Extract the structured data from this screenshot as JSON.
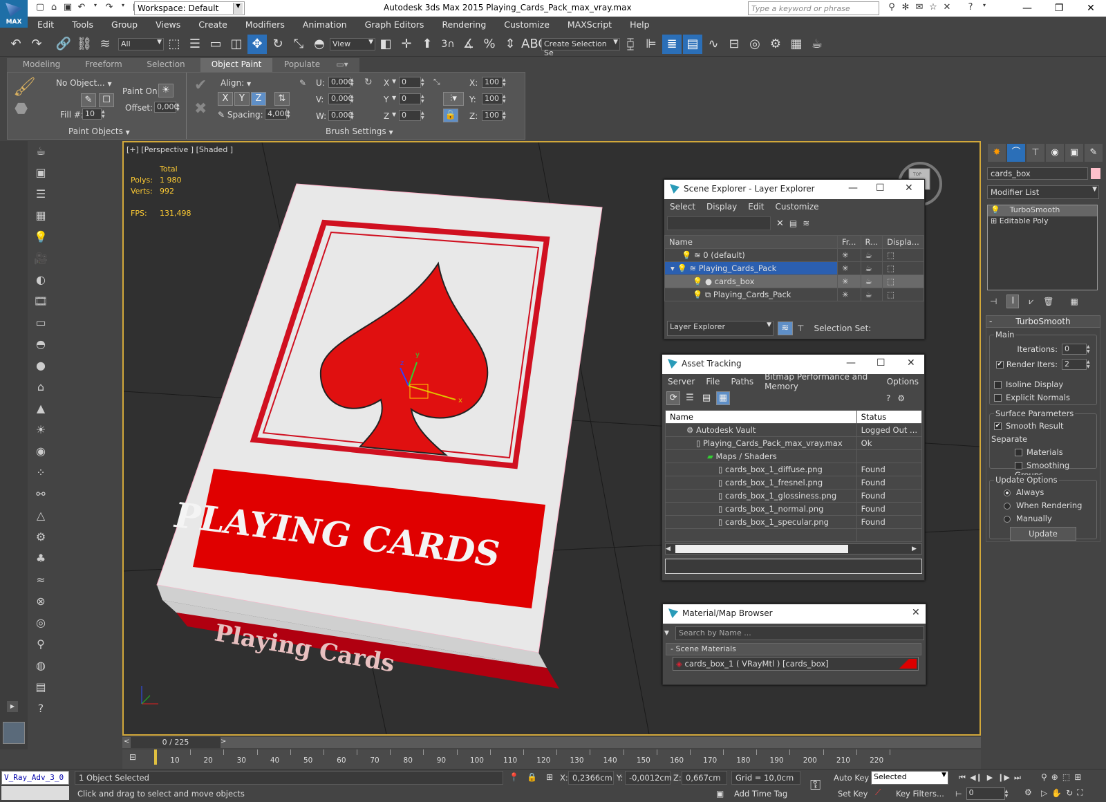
{
  "app": {
    "title": "Autodesk 3ds Max  2015    Playing_Cards_Pack_max_vray.max",
    "logo": "MAX"
  },
  "workspace": "Workspace: Default",
  "search": {
    "placeholder": "Type a keyword or phrase"
  },
  "menu": [
    "Edit",
    "Tools",
    "Group",
    "Views",
    "Create",
    "Modifiers",
    "Animation",
    "Graph Editors",
    "Rendering",
    "Customize",
    "MAXScript",
    "Help"
  ],
  "toolbar": {
    "filter": "All",
    "view": "View",
    "snap_label": "3",
    "selection_set": "Create Selection Se"
  },
  "ribbon": {
    "tabs": [
      "Modeling",
      "Freeform",
      "Selection",
      "Object Paint",
      "Populate"
    ],
    "active_tab": "Object Paint",
    "no_object": "No Object...",
    "paint_on": "Paint On:",
    "offset": "Offset:",
    "offset_val": "0,000",
    "fill": "Fill #:",
    "fill_val": "10",
    "paint_objects": "Paint Objects",
    "align": "Align:",
    "x": "X",
    "y": "Y",
    "z": "Z",
    "spacing": "Spacing:",
    "spacing_val": "4,000",
    "brush_settings": "Brush Settings",
    "u": "U:",
    "u_val": "0,000",
    "v": "V:",
    "v_val": "0,000",
    "w": "W:",
    "w_val": "0,000",
    "rx_val": "0",
    "ry_val": "0",
    "rz_val": "0",
    "sx": "X:",
    "sx_val": "100",
    "sy": "Y:",
    "sy_val": "100",
    "sz": "Z:",
    "sz_val": "100"
  },
  "viewport": {
    "label": "[+] [Perspective ] [Shaded ]",
    "stats_total": "Total",
    "polys_label": "Polys:",
    "polys": "1 980",
    "verts_label": "Verts:",
    "verts": "992",
    "fps_label": "FPS:",
    "fps": "131,498",
    "box_front_text": "PLAYING CARDS",
    "box_side_text": "Playing Cards",
    "gizmo_x": "x",
    "gizmo_y": "y",
    "gizmo_z": "z",
    "viewcube": "TOP"
  },
  "scene_explorer": {
    "title": "Scene Explorer - Layer Explorer",
    "menu": [
      "Select",
      "Display",
      "Edit",
      "Customize"
    ],
    "cols": [
      "Name",
      "Fr...",
      "R...",
      "Displa..."
    ],
    "rows": [
      "0 (default)",
      "Playing_Cards_Pack",
      "cards_box",
      "Playing_Cards_Pack"
    ],
    "footer_dd": "Layer Explorer",
    "selection_set": "Selection Set:"
  },
  "asset_tracking": {
    "title": "Asset Tracking",
    "menu": [
      "Server",
      "File",
      "Paths",
      "Bitmap Performance and Memory",
      "Options"
    ],
    "cols": [
      "Name",
      "Status"
    ],
    "rows": [
      {
        "name": "Autodesk Vault",
        "status": "Logged Out ..."
      },
      {
        "name": "Playing_Cards_Pack_max_vray.max",
        "status": "Ok"
      },
      {
        "name": "Maps / Shaders",
        "status": ""
      },
      {
        "name": "cards_box_1_diffuse.png",
        "status": "Found"
      },
      {
        "name": "cards_box_1_fresnel.png",
        "status": "Found"
      },
      {
        "name": "cards_box_1_glossiness.png",
        "status": "Found"
      },
      {
        "name": "cards_box_1_normal.png",
        "status": "Found"
      },
      {
        "name": "cards_box_1_specular.png",
        "status": "Found"
      }
    ]
  },
  "material_browser": {
    "title": "Material/Map Browser",
    "search_placeholder": "Search by Name ...",
    "group": "- Scene Materials",
    "item": "cards_box_1  ( VRayMtl )  [cards_box]"
  },
  "command_panel": {
    "object_name": "cards_box",
    "modifier_list": "Modifier List",
    "stack": [
      "TurboSmooth",
      "Editable Poly"
    ],
    "rollout": "TurboSmooth",
    "main": "Main",
    "iterations_label": "Iterations:",
    "iterations": "0",
    "render_iters_label": "Render Iters:",
    "render_iters": "2",
    "isoline": "Isoline Display",
    "explicit": "Explicit Normals",
    "surface": "Surface Parameters",
    "smooth_result": "Smooth Result",
    "separate": "Separate",
    "materials": "Materials",
    "smoothing_groups": "Smoothing Groups",
    "update_options": "Update Options",
    "always": "Always",
    "when_rendering": "When Rendering",
    "manually": "Manually",
    "update": "Update"
  },
  "timeline": {
    "frame": "0 / 225",
    "ticks": [
      "10",
      "20",
      "30",
      "40",
      "50",
      "60",
      "70",
      "80",
      "90",
      "100",
      "110",
      "120",
      "130",
      "140",
      "150",
      "160",
      "170",
      "180",
      "190",
      "200",
      "210",
      "220"
    ],
    "current_fraction": 0
  },
  "status": {
    "script_field": "V_Ray_Adv_3_0",
    "selected": "1 Object Selected",
    "prompt": "Click and drag to select and move objects",
    "x_label": "X:",
    "x": "0,2366cm",
    "y_label": "Y:",
    "y": "-0,0012cm",
    "z_label": "Z:",
    "z": "0,667cm",
    "grid": "Grid = 10,0cm",
    "add_time_tag": "Add Time Tag",
    "auto_key": "Auto Key",
    "set_key": "Set Key",
    "selected_dd": "Selected",
    "key_filters": "Key Filters...",
    "frame_field": "0"
  },
  "colors": {
    "accent": "#2b6fb8",
    "viewport_border": "#d2a83a",
    "card_red": "#e00000",
    "stat_text": "#ffcc33"
  }
}
